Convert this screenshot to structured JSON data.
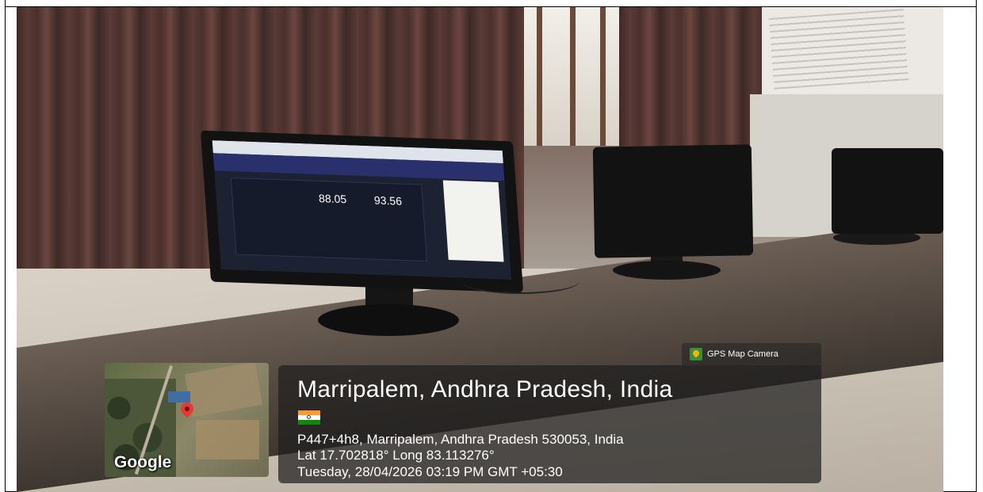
{
  "overlay": {
    "brand": "GPS Map Camera",
    "location_title": "Marripalem, Andhra Pradesh, India",
    "address": "P447+4h8, Marripalem, Andhra Pradesh 530053, India",
    "coordinates": "Lat 17.702818° Long 83.113276°",
    "datetime": "Tuesday, 28/04/2026 03:19 PM GMT +05:30",
    "map_label": "Google",
    "flag_icon": "india-flag-icon"
  },
  "screen": {
    "download_value": "88.05",
    "upload_value": "93.56"
  }
}
